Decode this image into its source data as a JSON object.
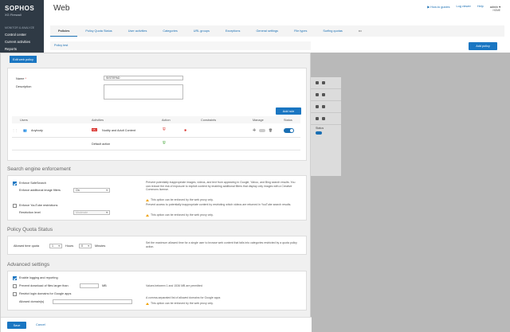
{
  "sidebar": {
    "brand": "SOPHOS",
    "product": "XG Firewall",
    "section": "MONITOR & ANALYZE",
    "items": [
      "Control center",
      "Current activities",
      "Reports"
    ]
  },
  "header": {
    "title": "Web",
    "links": [
      "How-to guides",
      "Log viewer",
      "Help"
    ],
    "user": "admin",
    "user_sub": "HOME"
  },
  "tabs": [
    "Policies",
    "Policy Quota Status",
    "User activities",
    "Categories",
    "URL groups",
    "Exceptions",
    "General settings",
    "File types",
    "Surfing quotas",
    "•••"
  ],
  "background": {
    "policy_row": "Policy test",
    "add_policy": "Add policy",
    "status_col": "Status"
  },
  "modal": {
    "edit_button": "Edit web policy",
    "name_label": "Name",
    "name_value": "SISTEPAD",
    "description_label": "Description",
    "add_rule": "Add rule",
    "rules_headers": [
      "Users",
      "Activities",
      "Action",
      "Constraints",
      "Manage",
      "Status"
    ],
    "rule": {
      "user": "Anybody",
      "activity": "Nudity and Adult Content"
    },
    "default_action": "Default action",
    "search": {
      "title": "Search engine enforcement",
      "safesearch": "Enforce SafeSearch",
      "image_filters_label": "Enforce additional image filters",
      "image_filters_value": "On",
      "safesearch_desc": "Prevent potentially inappropriate images, videos, and text from appearing in Google, Yahoo, and Bing search results. You can reduce the risk of exposure to explicit content by enabling additional filters that display only images with a Creative Commons license.",
      "safesearch_warn": "This option can be enforced by the web proxy only.",
      "youtube": "Enforce YouTube restrictions",
      "restriction_label": "Restriction level",
      "restriction_value": "Moderate",
      "youtube_desc": "Prevent access to potentially inappropriate content by restricting which videos are returned in YouTube search results.",
      "youtube_warn": "This option can be enforced by the web proxy only."
    },
    "quota": {
      "title": "Policy Quota Status",
      "allowed_label": "Allowed time quota",
      "hours_value": "1",
      "hours_label": "Hours",
      "minutes_value": "0",
      "minutes_label": "Minutes",
      "desc": "Set the maximum allowed time for a single user to browse web content that falls into categories restricted by a quota policy action."
    },
    "advanced": {
      "title": "Advanced settings",
      "logging": "Enable logging and reporting",
      "prevent_download": "Prevent download of files larger than",
      "mb": "MB",
      "download_desc": "Values between 1 and 1536 MB are permitted",
      "restrict_google": "Restrict login domains for Google apps",
      "allowed_domains_label": "Allowed domain(s)",
      "domains_desc": "A comma-separated list of allowed domains for Google apps",
      "domains_warn": "This option can be enforced by the web proxy only."
    },
    "save": "Save",
    "cancel": "Cancel"
  },
  "colors": {
    "accent": "#1a76c2",
    "sidebar": "#2f3a45",
    "warning": "#f0a30a",
    "block": "#d9302b",
    "allow": "#3aa12d"
  }
}
